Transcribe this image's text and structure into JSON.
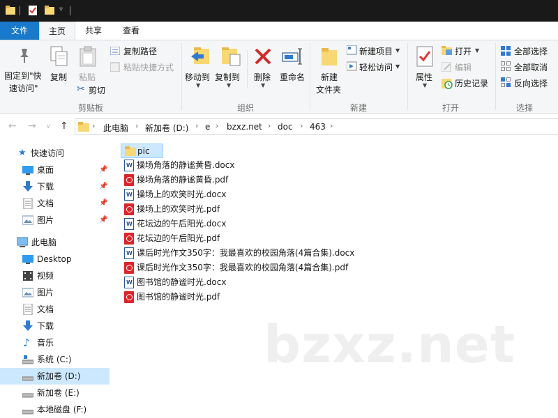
{
  "ribbon_tabs": [
    "文件",
    "主页",
    "共享",
    "查看"
  ],
  "ribbon": {
    "clipboard": {
      "pin_label_1": "固定到\"快",
      "pin_label_2": "速访问\"",
      "copy": "复制",
      "paste": "粘贴",
      "copy_path": "复制路径",
      "paste_shortcut": "粘贴快捷方式",
      "cut": "剪切",
      "group": "剪贴板"
    },
    "organize": {
      "move_to": "移动到",
      "copy_to": "复制到",
      "delete": "删除",
      "rename": "重命名",
      "group": "组织"
    },
    "new": {
      "new_folder_1": "新建",
      "new_folder_2": "文件夹",
      "new_item": "新建项目",
      "easy_access": "轻松访问",
      "group": "新建"
    },
    "open": {
      "properties": "属性",
      "open": "打开",
      "edit": "编辑",
      "history": "历史记录",
      "group": "打开"
    },
    "select": {
      "select_all": "全部选择",
      "select_none": "全部取消",
      "invert": "反向选择",
      "group": "选择"
    }
  },
  "address": {
    "crumbs": [
      "此电脑",
      "新加卷 (D:)",
      "e",
      "bzxz.net",
      "doc",
      "463"
    ]
  },
  "nav_pane": [
    {
      "label": "快速访问",
      "icon": "star-icon",
      "pinned": false
    },
    {
      "label": "桌面",
      "icon": "desktop-icon",
      "pinned": true
    },
    {
      "label": "下载",
      "icon": "download-icon",
      "pinned": true
    },
    {
      "label": "文档",
      "icon": "document-icon",
      "pinned": true
    },
    {
      "label": "图片",
      "icon": "pictures-icon",
      "pinned": true
    },
    {
      "label": "此电脑",
      "icon": "computer-icon",
      "pinned": false
    },
    {
      "label": "Desktop",
      "icon": "desktop-icon",
      "pinned": false
    },
    {
      "label": "视频",
      "icon": "video-icon",
      "pinned": false
    },
    {
      "label": "图片",
      "icon": "pictures-icon",
      "pinned": false
    },
    {
      "label": "文档",
      "icon": "document-icon",
      "pinned": false
    },
    {
      "label": "下载",
      "icon": "download-icon",
      "pinned": false
    },
    {
      "label": "音乐",
      "icon": "music-icon",
      "pinned": false
    },
    {
      "label": "系统 (C:)",
      "icon": "drive-icon",
      "pinned": false
    },
    {
      "label": "新加卷 (D:)",
      "icon": "drive-icon",
      "pinned": false,
      "selected": true
    },
    {
      "label": "新加卷 (E:)",
      "icon": "drive-icon",
      "pinned": false
    },
    {
      "label": "本地磁盘 (F:)",
      "icon": "drive-icon",
      "pinned": false
    }
  ],
  "files": [
    {
      "name": "pic",
      "type": "folder",
      "selected": true
    },
    {
      "name": "操场角落的静谧黄昏.docx",
      "type": "docx"
    },
    {
      "name": "操场角落的静谧黄昏.pdf",
      "type": "pdf"
    },
    {
      "name": "操场上的欢笑时光.docx",
      "type": "docx"
    },
    {
      "name": "操场上的欢笑时光.pdf",
      "type": "pdf"
    },
    {
      "name": "花坛边的午后阳光.docx",
      "type": "docx"
    },
    {
      "name": "花坛边的午后阳光.pdf",
      "type": "pdf"
    },
    {
      "name": "课后时光作文350字：我最喜欢的校园角落(4篇合集).docx",
      "type": "docx"
    },
    {
      "name": "课后时光作文350字：我最喜欢的校园角落(4篇合集).pdf",
      "type": "pdf"
    },
    {
      "name": "图书馆的静谧时光.docx",
      "type": "docx"
    },
    {
      "name": "图书馆的静谧时光.pdf",
      "type": "pdf"
    }
  ],
  "watermark": "bzxz.net",
  "colors": {
    "accent": "#1979ca",
    "selection": "#cce8ff",
    "folder": "#f8d775"
  }
}
